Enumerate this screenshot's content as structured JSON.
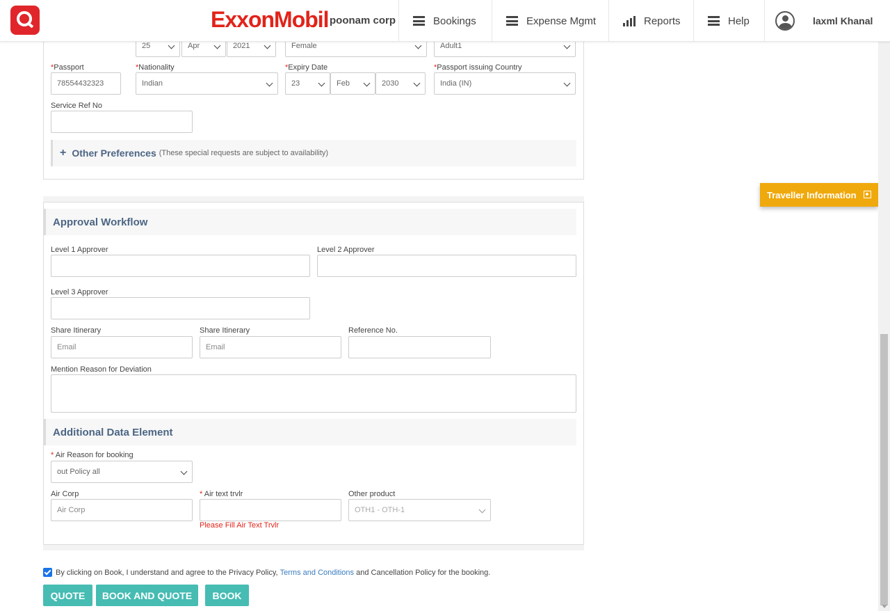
{
  "header": {
    "brand": "ExxonMobil",
    "corp": "poonam corp",
    "nav": {
      "bookings": "Bookings",
      "expense": "Expense Mgmt",
      "reports": "Reports",
      "help": "Help",
      "user": "laxml Khanal"
    }
  },
  "traveller": {
    "dob_day": "25",
    "dob_month": "Apr",
    "dob_year": "2021",
    "gender": "Female",
    "pax_type": "Adult1",
    "passport_label": "Passport",
    "passport_value": "78554432323",
    "nationality_label": "Nationality",
    "nationality_value": "Indian",
    "expiry_label": "Expiry Date",
    "expiry_day": "23",
    "expiry_month": "Feb",
    "expiry_year": "2030",
    "issuing_label": "Passport issuing Country",
    "issuing_value": "India (IN)",
    "service_ref_label": "Service Ref No",
    "service_ref_value": "",
    "prefs_title": "Other Preferences",
    "prefs_note": "(These special requests are subject to availability)"
  },
  "approval": {
    "title": "Approval Workflow",
    "level1_label": "Level 1 Approver",
    "level2_label": "Level 2 Approver",
    "level3_label": "Level 3 Approver",
    "share1_label": "Share Itinerary",
    "share1_placeholder": "Email",
    "share2_label": "Share Itinerary",
    "share2_placeholder": "Email",
    "reference_label": "Reference No.",
    "deviation_label": "Mention Reason for Deviation"
  },
  "additional": {
    "title": "Additional Data Element",
    "air_reason_label": "Air Reason for booking",
    "air_reason_value": "out Policy all",
    "air_corp_label": "Air Corp",
    "air_corp_placeholder": "Air Corp",
    "air_text_label": "Air text trvlr",
    "air_text_error": "Please Fill Air Text Trvlr",
    "other_product_label": "Other product",
    "other_product_value": "OTH1 - OTH-1"
  },
  "side_panel": {
    "traveller_info": "Traveller Information"
  },
  "consent": {
    "text_before": "By clicking on Book, I understand and agree to the Privacy Policy,",
    "link": "Terms and Conditions",
    "text_after": "and Cancellation Policy for the booking."
  },
  "buttons": {
    "quote": "QUOTE",
    "book_and_quote": "BOOK AND QUOTE",
    "book": "BOOK"
  },
  "colors": {
    "brand_red": "#e2231a",
    "accent_teal": "#46bcb3",
    "side_panel_orange": "#f0a90c",
    "section_title_blue": "#4b6584"
  }
}
